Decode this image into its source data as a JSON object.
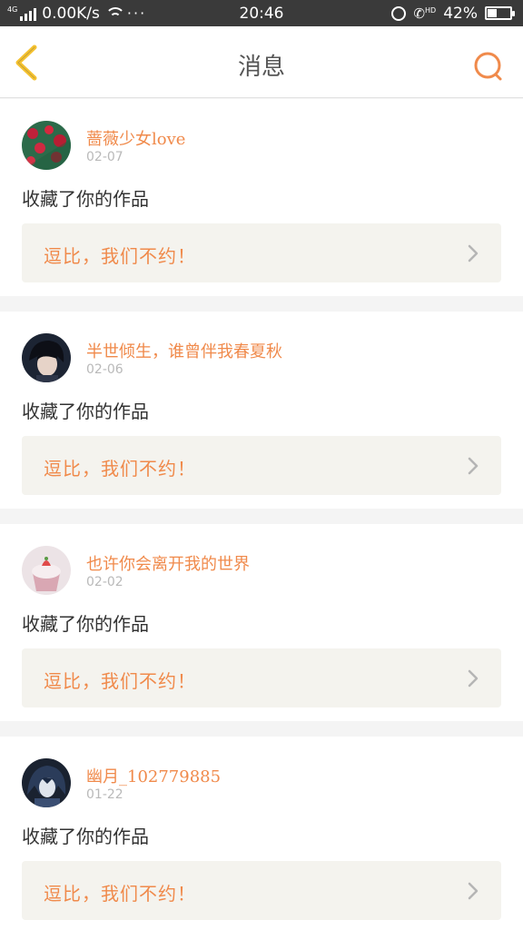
{
  "status_bar": {
    "network_type": "4G",
    "speed": "0.00K/s",
    "more": "···",
    "time": "20:46",
    "hd": "HD",
    "battery_percent": "42%",
    "battery_level": 0.42
  },
  "header": {
    "title": "消息",
    "back_icon": "chevron-left-icon",
    "search_icon": "search-icon"
  },
  "colors": {
    "accent": "#f08a4b",
    "back_yellow": "#f5c230",
    "card_box_bg": "#f4f3ee",
    "date_gray": "#b9b9b9"
  },
  "messages": [
    {
      "username": "蔷薇少女love",
      "date": "02-07",
      "action": "收藏了你的作品",
      "work_title": "逗比，我们不约！",
      "avatar": "roses-avatar"
    },
    {
      "username": "半世倾生，谁曾伴我春夏秋",
      "date": "02-06",
      "action": "收藏了你的作品",
      "work_title": "逗比，我们不约！",
      "avatar": "portrait-avatar"
    },
    {
      "username": "也许你会离开我的世界",
      "date": "02-02",
      "action": "收藏了你的作品",
      "work_title": "逗比，我们不约！",
      "avatar": "cupcake-avatar"
    },
    {
      "username": "幽月_102779885",
      "date": "01-22",
      "action": "收藏了你的作品",
      "work_title": "逗比，我们不约！",
      "avatar": "anime-avatar"
    }
  ]
}
